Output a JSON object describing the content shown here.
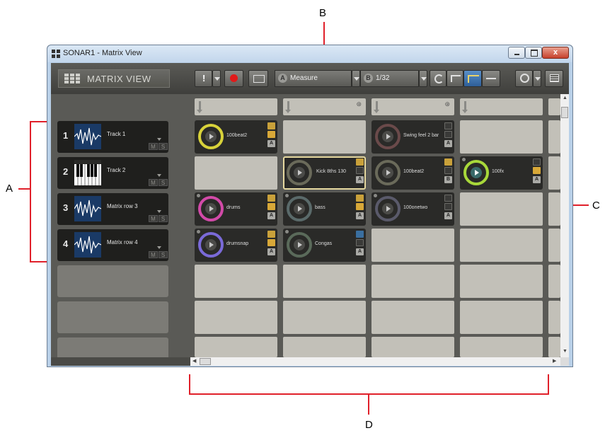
{
  "callouts": {
    "a": "A",
    "b": "B",
    "c": "C",
    "d": "D"
  },
  "window": {
    "title": "SONAR1 - Matrix View"
  },
  "toolbar": {
    "view_title": "MATRIX VIEW",
    "trigger_letter_a": "A",
    "trigger_resolution": "Measure",
    "trigger_letter_b": "B",
    "quantize": "1/32"
  },
  "tracks": [
    {
      "number": "1",
      "name": "Track 1",
      "type": "audio"
    },
    {
      "number": "2",
      "name": "Track 2",
      "type": "instrument"
    },
    {
      "number": "3",
      "name": "Matrix row 3",
      "type": "audio"
    },
    {
      "number": "4",
      "name": "Matrix row 4",
      "type": "audio"
    }
  ],
  "mute_label": "M",
  "solo_label": "S",
  "clips": {
    "r1c1": {
      "name": "100beat2",
      "letter": "A",
      "ring_color": "#d8d23a"
    },
    "r1c3": {
      "name": "Swing feel 2  bar",
      "letter": "A",
      "ring_color": "#6a4a4a"
    },
    "r2c2": {
      "name": "Kick 8ths 130",
      "letter": "A",
      "ring_color": "#6a6a5a"
    },
    "r2c3": {
      "name": "100beat2",
      "letter": "B",
      "ring_color": "#6a6a5a"
    },
    "r2c4": {
      "name": "100fx",
      "letter": "A",
      "ring_color": "#a8d83a"
    },
    "r3c1": {
      "name": "drums",
      "letter": "A",
      "ring_color": "#d24aa8"
    },
    "r3c2": {
      "name": "bass",
      "letter": "A",
      "ring_color": "#5a6a6a"
    },
    "r3c3": {
      "name": "100onetwo",
      "letter": "A",
      "ring_color": "#5a5a6a"
    },
    "r4c1": {
      "name": "drumsnap",
      "letter": "A",
      "ring_color": "#7a6ad8"
    },
    "r4c2": {
      "name": "Congas",
      "letter": "A",
      "ring_color": "#5a6a5a"
    }
  }
}
